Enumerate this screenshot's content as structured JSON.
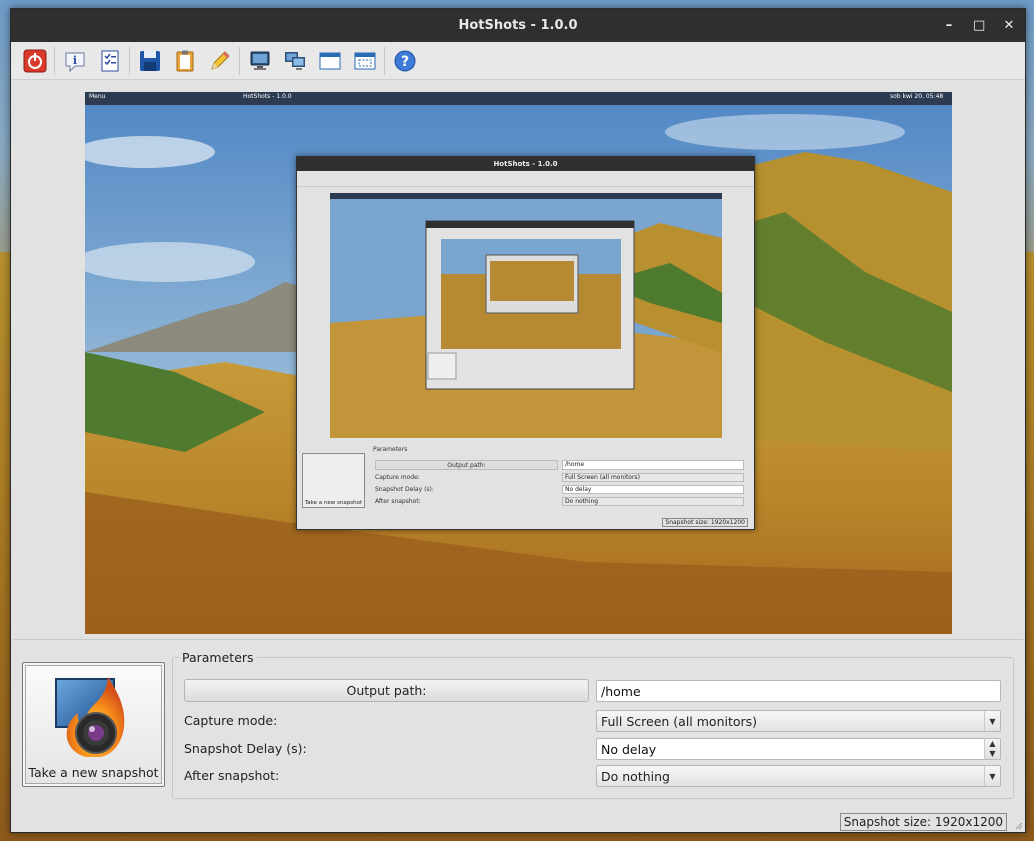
{
  "window": {
    "title": "HotShots - 1.0.0",
    "controls": {
      "minimize": "–",
      "maximize": "□",
      "close": "✕"
    }
  },
  "toolbar": {
    "buttons": [
      {
        "name": "quit-button",
        "icon": "power-icon"
      },
      {
        "name": "about-button",
        "icon": "info-icon"
      },
      {
        "name": "preferences-button",
        "icon": "checklist-icon"
      },
      {
        "name": "save-button",
        "icon": "floppy-icon"
      },
      {
        "name": "copy-clipboard-button",
        "icon": "clipboard-icon"
      },
      {
        "name": "edit-button",
        "icon": "pencil-icon"
      },
      {
        "name": "capture-screen-button",
        "icon": "monitor-icon"
      },
      {
        "name": "capture-all-screens-button",
        "icon": "multi-monitor-icon"
      },
      {
        "name": "capture-window-button",
        "icon": "window-icon"
      },
      {
        "name": "capture-region-button",
        "icon": "region-icon"
      },
      {
        "name": "help-button",
        "icon": "help-icon"
      }
    ]
  },
  "preview": {
    "taskbar": {
      "menu": "Menu",
      "window_title": "HotShots - 1.0.0",
      "clock": "sob kwi 20, 05:48"
    },
    "nested_window": {
      "title": "HotShots - 1.0.0",
      "params_title": "Parameters",
      "output_path_label": "Output path:",
      "output_path_value": "/home",
      "capture_mode_label": "Capture mode:",
      "capture_mode_value": "Full Screen (all monitors)",
      "delay_label": "Snapshot Delay (s):",
      "delay_value": "No delay",
      "after_label": "After snapshot:",
      "after_value": "Do nothing",
      "snap_label": "Take a new snapshot",
      "status": "Snapshot size: 1920x1200"
    }
  },
  "snapshot": {
    "label": "Take a new snapshot",
    "icon": "camera-flame-icon"
  },
  "parameters": {
    "title": "Parameters",
    "output_path_button": "Output path:",
    "output_path_value": "/home",
    "capture_mode_label": "Capture mode:",
    "capture_mode_value": "Full Screen (all monitors)",
    "delay_label": "Snapshot Delay (s):",
    "delay_value": "No delay",
    "after_label": "After snapshot:",
    "after_value": "Do nothing"
  },
  "status_bar": {
    "snapshot_size": "Snapshot size: 1920x1200"
  },
  "colors": {
    "titlebar": "#2f2f2f",
    "window_bg": "#e2e2e2",
    "accent_flame": "#f08a1c",
    "sky": "#6d9ac4",
    "grass": "#b8902f"
  }
}
